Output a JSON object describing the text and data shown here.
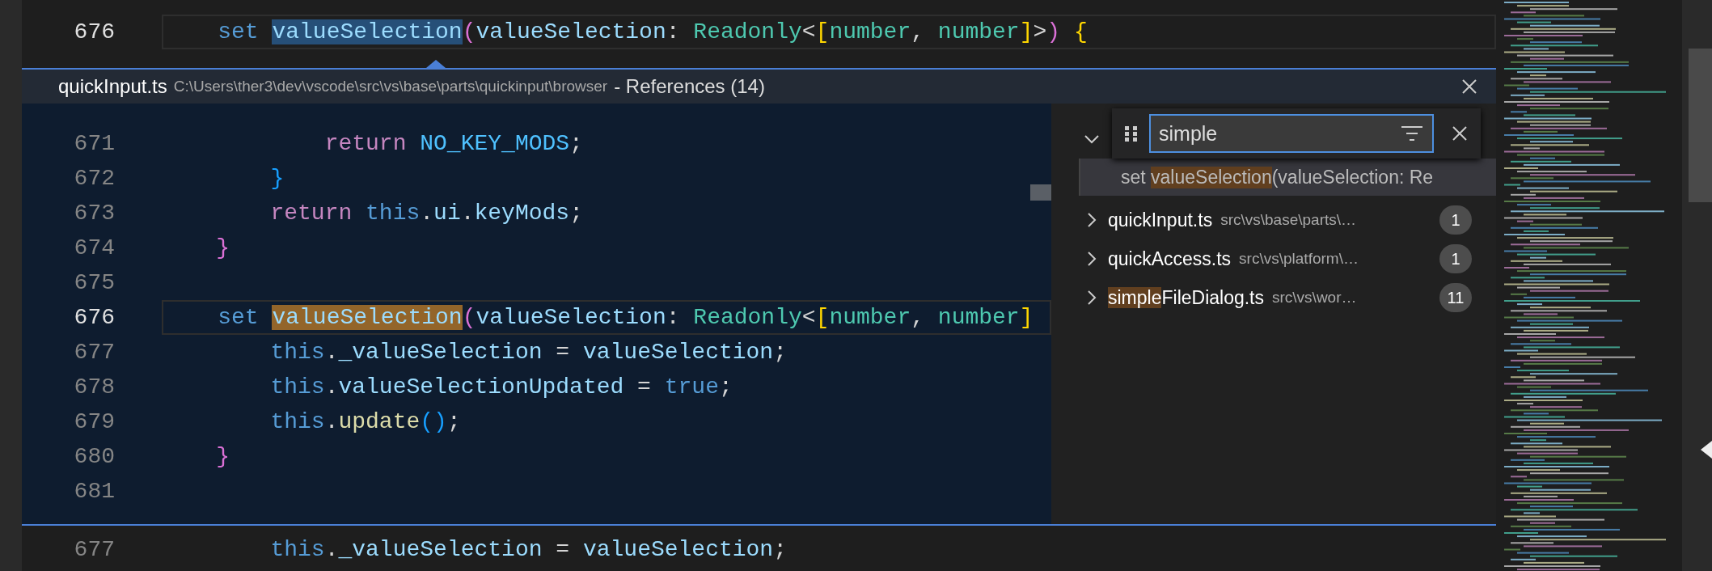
{
  "top_editor": {
    "lines": [
      {
        "number": "676",
        "current": true,
        "tokens": [
          {
            "text": "    set ",
            "kind": "kw"
          },
          {
            "text": "valueSelection",
            "kind": "sel"
          },
          {
            "text": "(",
            "kind": "b2"
          },
          {
            "text": "valueSelection",
            "kind": "var"
          },
          {
            "text": ": ",
            "kind": "p"
          },
          {
            "text": "Readonly",
            "kind": "type"
          },
          {
            "text": "<",
            "kind": "p"
          },
          {
            "text": "[",
            "kind": "b1"
          },
          {
            "text": "number",
            "kind": "type"
          },
          {
            "text": ", ",
            "kind": "p"
          },
          {
            "text": "number",
            "kind": "type"
          },
          {
            "text": "]",
            "kind": "b1"
          },
          {
            "text": ">",
            "kind": "p"
          },
          {
            "text": ")",
            "kind": "b2"
          },
          {
            "text": " {",
            "kind": "b1"
          }
        ]
      }
    ]
  },
  "peek": {
    "file": "quickInput.ts",
    "path": "C:\\Users\\ther3\\dev\\vscode\\src\\vs\\base\\parts\\quickinput\\browser",
    "title": "- References (14)",
    "lines": [
      {
        "number": "671",
        "current": false,
        "tokens": [
          {
            "text": "            return ",
            "kind": "ctrl"
          },
          {
            "text": "NO_KEY_MODS",
            "kind": "const"
          },
          {
            "text": ";",
            "kind": "p"
          }
        ]
      },
      {
        "number": "672",
        "current": false,
        "tokens": [
          {
            "text": "        }",
            "kind": "b3"
          }
        ]
      },
      {
        "number": "673",
        "current": false,
        "tokens": [
          {
            "text": "        return ",
            "kind": "ctrl"
          },
          {
            "text": "this",
            "kind": "kw"
          },
          {
            "text": ".",
            "kind": "p"
          },
          {
            "text": "ui",
            "kind": "var"
          },
          {
            "text": ".",
            "kind": "p"
          },
          {
            "text": "keyMods",
            "kind": "var"
          },
          {
            "text": ";",
            "kind": "p"
          }
        ]
      },
      {
        "number": "674",
        "current": false,
        "tokens": [
          {
            "text": "    }",
            "kind": "b2"
          }
        ]
      },
      {
        "number": "675",
        "current": false
      },
      {
        "number": "676",
        "current": true,
        "tokens": [
          {
            "text": "    set ",
            "kind": "kw"
          },
          {
            "text": "valueSelection",
            "kind": "match"
          },
          {
            "text": "(",
            "kind": "b2"
          },
          {
            "text": "valueSelection",
            "kind": "var"
          },
          {
            "text": ": ",
            "kind": "p"
          },
          {
            "text": "Readonly",
            "kind": "type"
          },
          {
            "text": "<",
            "kind": "p"
          },
          {
            "text": "[",
            "kind": "b1"
          },
          {
            "text": "number",
            "kind": "type"
          },
          {
            "text": ", ",
            "kind": "p"
          },
          {
            "text": "number",
            "kind": "type"
          },
          {
            "text": "]",
            "kind": "b1"
          }
        ]
      },
      {
        "number": "677",
        "current": false,
        "tokens": [
          {
            "text": "        this",
            "kind": "kw"
          },
          {
            "text": ".",
            "kind": "p"
          },
          {
            "text": "_valueSelection",
            "kind": "var"
          },
          {
            "text": " = ",
            "kind": "p"
          },
          {
            "text": "valueSelection",
            "kind": "var"
          },
          {
            "text": ";",
            "kind": "p"
          }
        ]
      },
      {
        "number": "678",
        "current": false,
        "tokens": [
          {
            "text": "        this",
            "kind": "kw"
          },
          {
            "text": ".",
            "kind": "p"
          },
          {
            "text": "valueSelectionUpdated",
            "kind": "var"
          },
          {
            "text": " = ",
            "kind": "p"
          },
          {
            "text": "true",
            "kind": "kw"
          },
          {
            "text": ";",
            "kind": "p"
          }
        ]
      },
      {
        "number": "679",
        "current": false,
        "tokens": [
          {
            "text": "        this",
            "kind": "kw"
          },
          {
            "text": ".",
            "kind": "p"
          },
          {
            "text": "update",
            "kind": "fn"
          },
          {
            "text": "()",
            "kind": "b3"
          },
          {
            "text": ";",
            "kind": "p"
          }
        ]
      },
      {
        "number": "680",
        "current": false,
        "tokens": [
          {
            "text": "    }",
            "kind": "b2"
          }
        ]
      },
      {
        "number": "681",
        "current": false
      }
    ],
    "references": {
      "filter": {
        "value": "simple"
      },
      "groups": [
        {
          "expanded": true,
          "children": [
            {
              "selected": true,
              "parts": [
                {
                  "text": "set ",
                  "match": false
                },
                {
                  "text": "valueSelection",
                  "match": true
                },
                {
                  "text": "(valueSelection: Re",
                  "match": false
                }
              ]
            }
          ]
        },
        {
          "expanded": false,
          "name_parts": [
            {
              "text": "quickInput.ts",
              "match": false
            }
          ],
          "path": "src\\vs\\base\\parts\\…",
          "count": "1"
        },
        {
          "expanded": false,
          "name_parts": [
            {
              "text": "quickAccess.ts",
              "match": false
            }
          ],
          "path": "src\\vs\\platform\\…",
          "count": "1"
        },
        {
          "expanded": false,
          "name_parts": [
            {
              "text": "simple",
              "match": true
            },
            {
              "text": "FileDialog.ts",
              "match": false
            }
          ],
          "path": "src\\vs\\wor…",
          "count": "11"
        }
      ]
    }
  },
  "bottom_editor": {
    "lines": [
      {
        "number": "677",
        "current": false,
        "tokens": [
          {
            "text": "        this",
            "kind": "kw"
          },
          {
            "text": ".",
            "kind": "p"
          },
          {
            "text": "_valueSelection",
            "kind": "var"
          },
          {
            "text": " = ",
            "kind": "p"
          },
          {
            "text": "valueSelection",
            "kind": "var"
          },
          {
            "text": ";",
            "kind": "p"
          }
        ]
      }
    ]
  }
}
